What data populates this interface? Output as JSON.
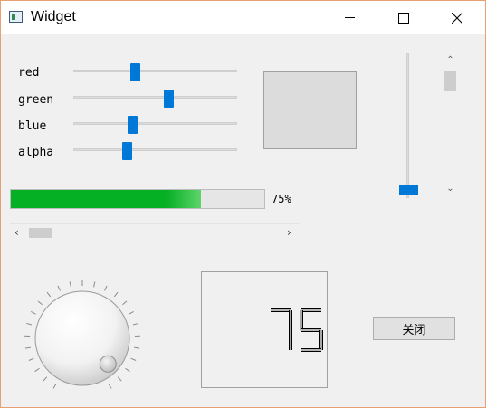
{
  "window": {
    "title": "Widget"
  },
  "sliders": [
    {
      "label": "red",
      "value": 0.37
    },
    {
      "label": "green",
      "value": 0.59
    },
    {
      "label": "blue",
      "value": 0.35
    },
    {
      "label": "alpha",
      "value": 0.32
    }
  ],
  "color_preview": {
    "color": "#dcdcdc"
  },
  "vertical_slider": {
    "value": 0.02
  },
  "vertical_scrollbar": {
    "value": 0.0
  },
  "progress": {
    "value": 75,
    "text": "75%"
  },
  "horizontal_scrollbar": {
    "value": 0.0
  },
  "dial": {
    "value": 0.95
  },
  "lcd": {
    "value": "75"
  },
  "buttons": {
    "close_label": "关闭"
  },
  "colors": {
    "accent": "#0078d7",
    "progress_green": "#06b025"
  }
}
